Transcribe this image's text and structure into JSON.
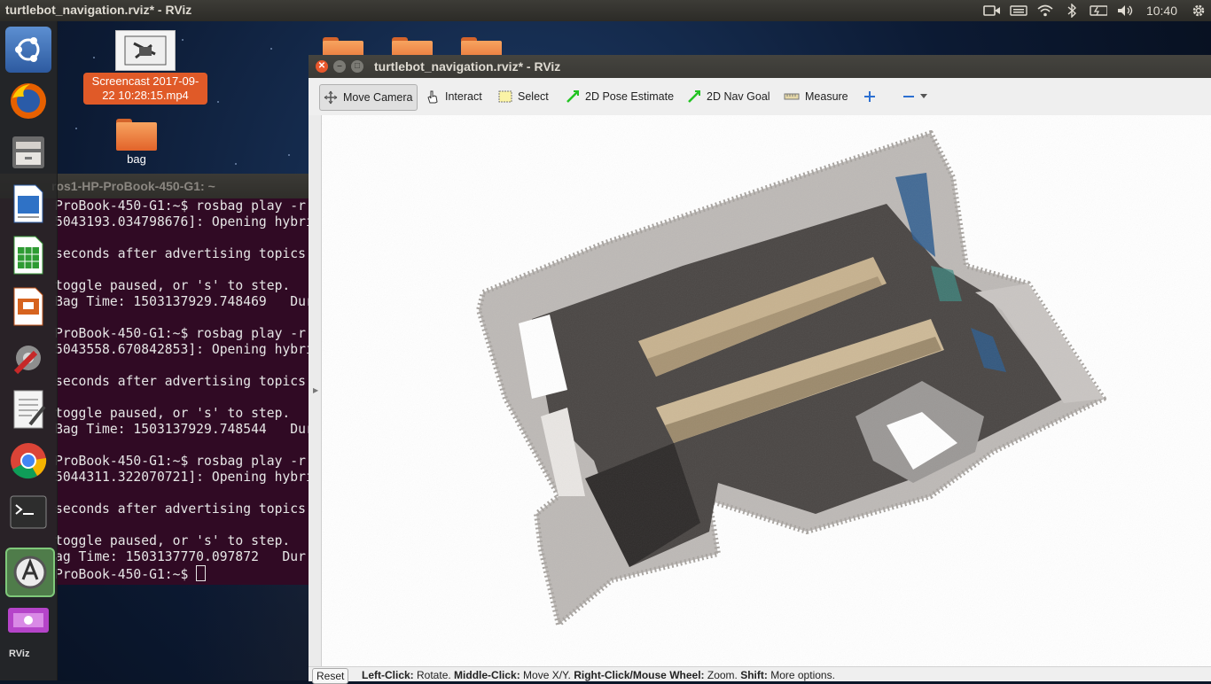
{
  "top_panel": {
    "window_title": "turtlebot_navigation.rviz* - RViz",
    "clock": "10:40"
  },
  "desktop": {
    "icons": [
      {
        "label": "Screencast 2017-09-22 10:28:15.mp4"
      },
      {
        "label": "bag"
      }
    ]
  },
  "terminal": {
    "title": "ros1-HP-ProBook-450-G1: ~",
    "lines": [
      "ProBook-450-G1:~$ rosbag play -r",
      "5043193.034798676]: Opening hybri",
      "",
      "seconds after advertising topics.",
      "",
      "toggle paused, or 's' to step.",
      "Bag Time: 1503137929.748469   Dur",
      "",
      "ProBook-450-G1:~$ rosbag play -r",
      "5043558.670842853]: Opening hybri",
      "",
      "seconds after advertising topics.",
      "",
      "toggle paused, or 's' to step.",
      "Bag Time: 1503137929.748544   Dur",
      "",
      "ProBook-450-G1:~$ rosbag play -r",
      "5044311.322070721]: Opening hybri",
      "",
      "seconds after advertising topics.",
      "",
      "toggle paused, or 's' to step.",
      "ag Time: 1503137770.097872   Dur",
      "ProBook-450-G1:~$ "
    ]
  },
  "rviz": {
    "title": "turtlebot_navigation.rviz* - RViz",
    "toolbar": {
      "move_camera": "Move Camera",
      "interact": "Interact",
      "select": "Select",
      "pose_estimate": "2D Pose Estimate",
      "nav_goal": "2D Nav Goal",
      "measure": "Measure"
    },
    "status": {
      "reset": "Reset",
      "left_click_label": "Left-Click:",
      "left_click_action": " Rotate. ",
      "middle_click_label": "Middle-Click:",
      "middle_click_action": " Move X/Y. ",
      "right_click_label": "Right-Click/Mouse Wheel:",
      "right_click_action": " Zoom. ",
      "shift_label": "Shift:",
      "shift_action": " More options."
    }
  },
  "launcher": {
    "items": [
      "ubuntu-icon",
      "firefox-icon",
      "files-icon",
      "writer-icon",
      "calc-icon",
      "impress-icon",
      "settings-icon",
      "text-editor-icon",
      "chrome-icon",
      "terminal-icon",
      "software-updater-icon",
      "rviz-icon"
    ]
  }
}
